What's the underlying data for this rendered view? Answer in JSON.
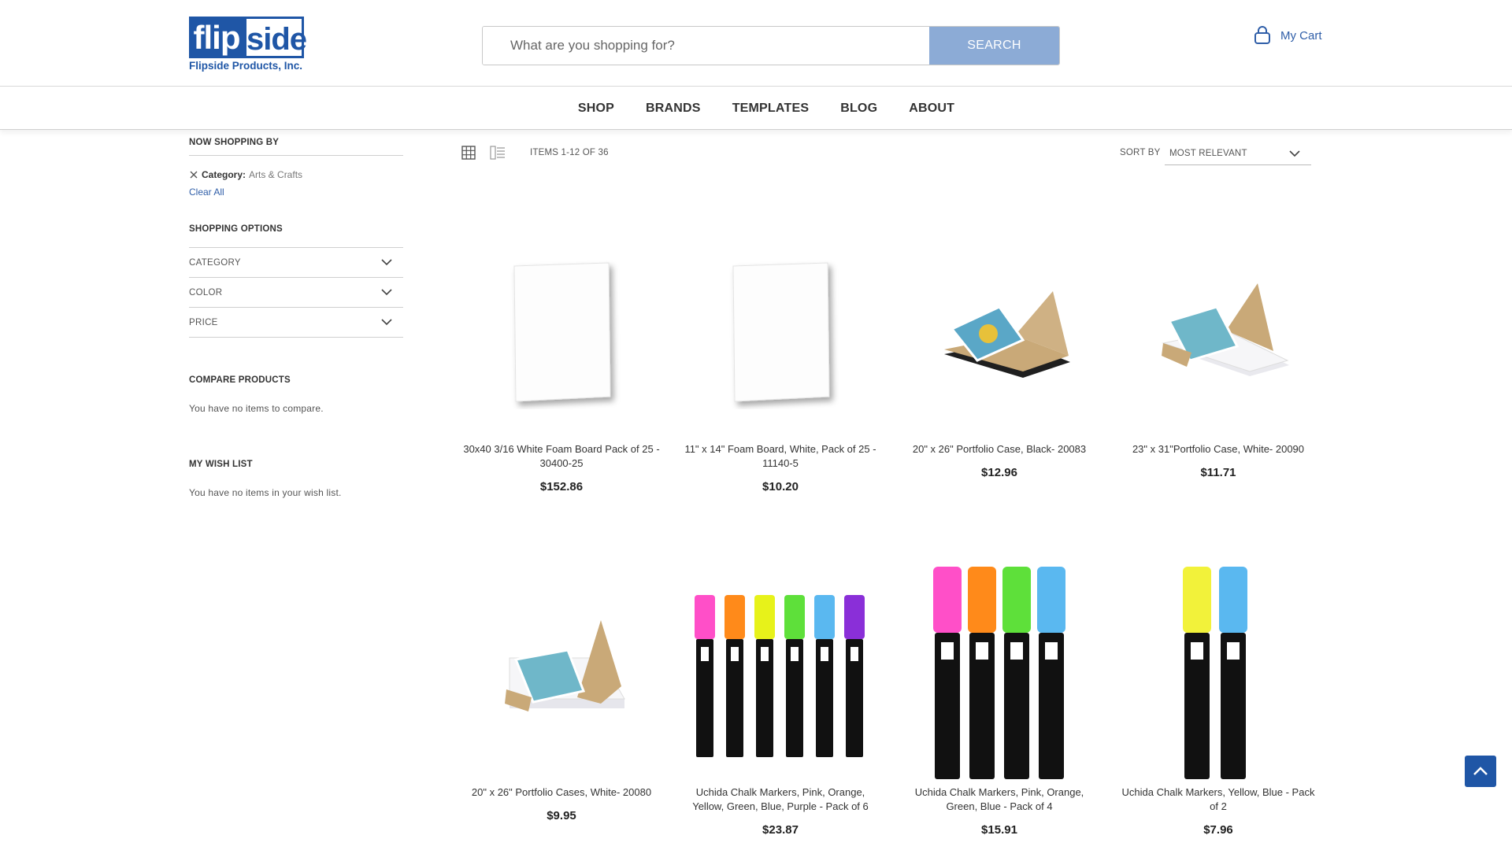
{
  "header": {
    "logo_left": "flip",
    "logo_right": "side",
    "logo_subtitle": "Flipside Products, Inc.",
    "search_placeholder": "What are you shopping for?",
    "search_button": "SEARCH",
    "cart_label": "My Cart"
  },
  "nav": {
    "items": [
      "SHOP",
      "BRANDS",
      "TEMPLATES",
      "BLOG",
      "ABOUT"
    ]
  },
  "sidebar": {
    "now_shopping_by": "NOW SHOPPING BY",
    "filter_label": "Category:",
    "filter_value": "Arts & Crafts",
    "clear_all": "Clear All",
    "shopping_options": "SHOPPING OPTIONS",
    "options": [
      "CATEGORY",
      "COLOR",
      "PRICE"
    ],
    "compare_title": "COMPARE PRODUCTS",
    "compare_text": "You have no items to compare.",
    "wishlist_title": "MY WISH LIST",
    "wishlist_text": "You have no items in your wish list."
  },
  "toolbar": {
    "items_count": "ITEMS 1-12 OF 36",
    "sort_label": "SORT BY",
    "sort_value": "MOST RELEVANT"
  },
  "products": [
    {
      "name": "30x40 3/16 White Foam Board Pack of 25 - 30400-25",
      "price": "$152.86",
      "image": "white-foam-board"
    },
    {
      "name": "11\" x 14\" Foam Board, White, Pack of 25 - 11140-5",
      "price": "$10.20",
      "image": "white-foam-board"
    },
    {
      "name": "20\" x 26\" Portfolio Case, Black- 20083",
      "price": "$12.96",
      "image": "portfolio-case-black"
    },
    {
      "name": "23\" x 31\"Portfolio Case, White- 20090",
      "price": "$11.71",
      "image": "portfolio-case-white"
    },
    {
      "name": "20\" x 26\" Portfolio Cases, White- 20080",
      "price": "$9.95",
      "image": "portfolio-case-white"
    },
    {
      "name": "Uchida Chalk Markers, Pink, Orange, Yellow, Green, Blue, Purple - Pack of 6",
      "price": "$23.87",
      "image": "chalk-markers-6"
    },
    {
      "name": "Uchida Chalk Markers, Pink, Orange, Green, Blue - Pack of 4",
      "price": "$15.91",
      "image": "chalk-markers-4"
    },
    {
      "name": "Uchida Chalk Markers, Yellow, Blue - Pack of 2",
      "price": "$7.96",
      "image": "chalk-markers-2"
    }
  ],
  "colors": {
    "brand": "#1f56a6",
    "search_button": "#8cabd6",
    "link": "#2f5ea8"
  }
}
